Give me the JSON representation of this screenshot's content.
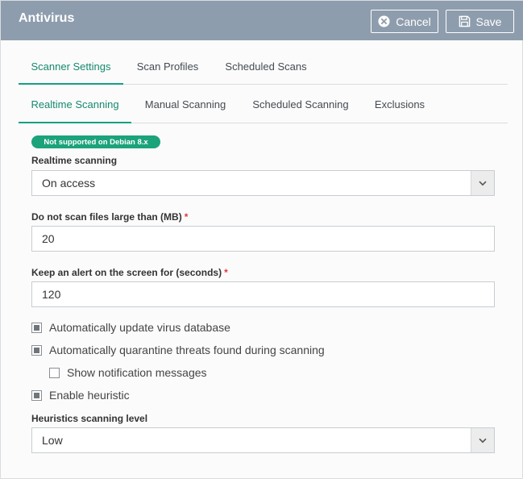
{
  "header": {
    "title": "Antivirus",
    "cancel_label": "Cancel",
    "save_label": "Save"
  },
  "tabs_main": [
    {
      "label": "Scanner Settings",
      "active": true
    },
    {
      "label": "Scan Profiles",
      "active": false
    },
    {
      "label": "Scheduled Scans",
      "active": false
    }
  ],
  "tabs_sub": [
    {
      "label": "Realtime Scanning",
      "active": true
    },
    {
      "label": "Manual Scanning",
      "active": false
    },
    {
      "label": "Scheduled Scanning",
      "active": false
    },
    {
      "label": "Exclusions",
      "active": false
    }
  ],
  "badge": "Not supported on Debian 8.x",
  "realtime": {
    "label": "Realtime scanning",
    "value": "On access"
  },
  "max_size": {
    "label": "Do not scan files large than (MB)",
    "required": "*",
    "value": "20"
  },
  "alert_time": {
    "label": "Keep an alert on the screen for (seconds)",
    "required": "*",
    "value": "120"
  },
  "options": [
    {
      "label": "Automatically update virus database",
      "checked": true
    },
    {
      "label": "Automatically quarantine threats found during scanning",
      "checked": true
    },
    {
      "label": "Show notification messages",
      "checked": false
    },
    {
      "label": "Enable heuristic",
      "checked": true
    }
  ],
  "heuristics": {
    "label": "Heuristics scanning level",
    "value": "Low"
  },
  "colors": {
    "header_bg": "#8e9dad",
    "accent": "#16a085",
    "badge_bg": "#1ca37b",
    "required": "#e0393e"
  },
  "icons": {
    "cancel": "close-circle-icon",
    "save": "floppy-disk-icon",
    "select": "chevron-down-icon"
  }
}
